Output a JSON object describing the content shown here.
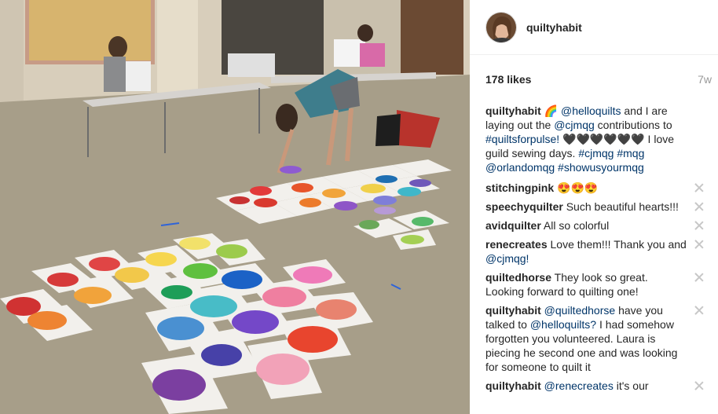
{
  "post": {
    "username": "quiltyhabit",
    "likes": "178 likes",
    "age": "7w"
  },
  "caption": {
    "user": "quiltyhabit",
    "text": "🌈 @helloquilts and I are laying out the @cjmqg contributions to #quiltsforpulse! 🖤🖤🖤🖤🖤🖤 I love guild sewing days. #cjmqg #mqg @orlandomqg #showusyourmqg"
  },
  "comments": [
    {
      "user": "stitchingpink",
      "text": "😍😍😍"
    },
    {
      "user": "speechyquilter",
      "text": "Such beautiful hearts!!!"
    },
    {
      "user": "avidquilter",
      "text": "All so colorful"
    },
    {
      "user": "renecreates",
      "text": "Love them!!! Thank you and @cjmqg!"
    },
    {
      "user": "quiltedhorse",
      "text": "They look so great. Looking forward to quilting one!"
    },
    {
      "user": "quiltyhabit",
      "text": "@quiltedhorse have you talked to @helloquilts? I had somehow forgotten you volunteered. Laura is piecing he second one and was looking for someone to quilt it"
    },
    {
      "user": "quiltyhabit",
      "text": "@renecreates it's our"
    }
  ],
  "icons": {
    "avatar": "avatar",
    "delete": "close-icon"
  },
  "colors": {
    "floor": "#a89f8b",
    "wall": "#d9cfbd",
    "link": "#003569",
    "delete": "#c7c7c7"
  }
}
